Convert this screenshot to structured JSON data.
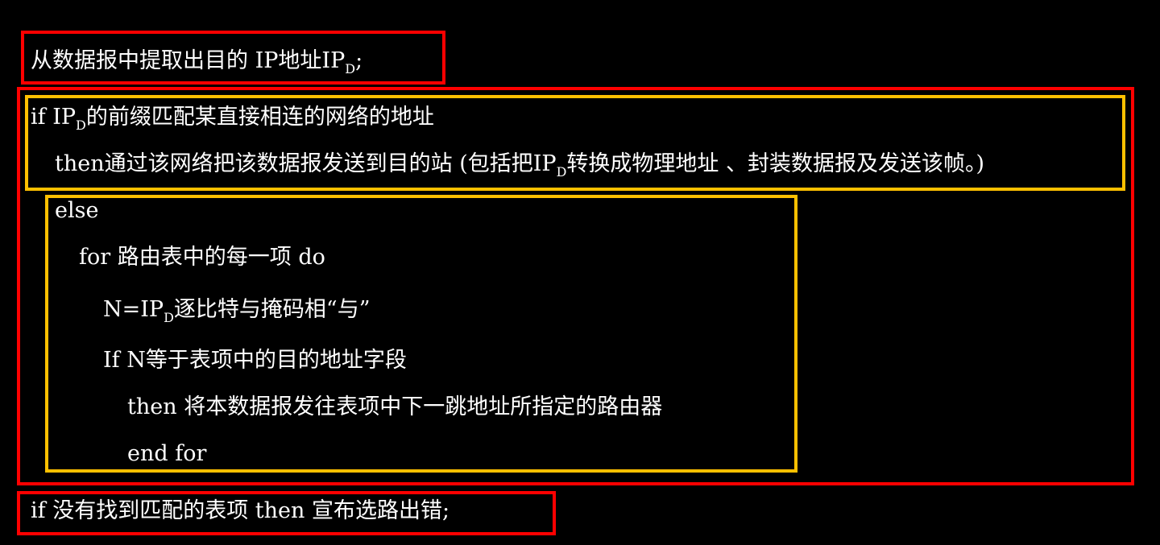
{
  "colors": {
    "background": "#000000",
    "text": "#ffffff",
    "outer_box": "#ff0000",
    "inner_box": "#ffc000"
  },
  "algorithm": {
    "step1": {
      "text": "从数据报中提取出目的 IP地址IP",
      "sub": "D",
      "after": ";"
    },
    "direct": {
      "if_text": "if IP",
      "if_sub": "D",
      "if_after": "的前缀匹配某直接相连的网络的地址",
      "then_text": "then通过该网络把该数据报发送到目的站 (包括把IP",
      "then_sub": "D",
      "then_after": "转换成物理地址 、封装数据报及发送该帧。)"
    },
    "route": {
      "else_text": "else",
      "for_text": "for 路由表中的每一项  do",
      "n_text": "N=IP",
      "n_sub": "D",
      "n_after": "逐比特与掩码相“与”",
      "if_text": "If  N等于表项中的目的地址字段",
      "then_text": "then 将本数据报发往表项中下一跳地址所指定的路由器",
      "endfor_text": "end for"
    },
    "last": {
      "text": "if 没有找到匹配的表项   then 宣布选路出错;"
    }
  }
}
